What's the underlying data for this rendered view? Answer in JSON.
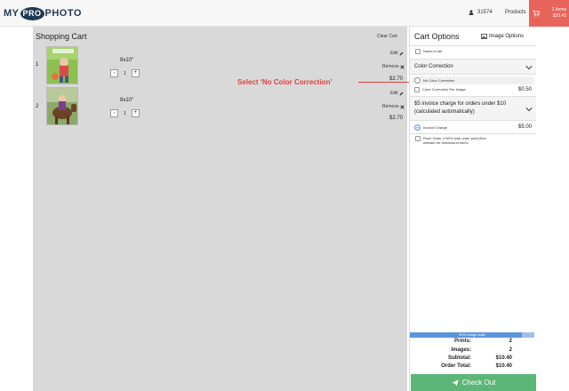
{
  "header": {
    "logo": {
      "my": "MY",
      "pro": "PRO",
      "photo": "PHOTO"
    },
    "user_id": "31574",
    "products_link": "Products",
    "cart_items": "2 Items",
    "cart_total": "$10.40",
    "user_icon": "user-icon",
    "cart_icon": "shopping-cart-icon"
  },
  "cart": {
    "title": "Shopping Cart",
    "clear_label": "Clear Cart",
    "items": [
      {
        "num": "1",
        "size": "8x10\"",
        "qty": "1",
        "edit": "Edit",
        "remove": "Remove",
        "price": "$2.70",
        "minus": "-",
        "plus": "+"
      },
      {
        "num": "2",
        "size": "8x10\"",
        "qty": "1",
        "edit": "Edit",
        "remove": "Remove",
        "price": "$2.70",
        "minus": "-",
        "plus": "+"
      }
    ]
  },
  "annotation": "Select ‘No Color Correction’",
  "options": {
    "title": "Cart Options",
    "image_options": "Image Options",
    "notes_label": "Notes to lab",
    "color_correction": {
      "header": "Color Correction",
      "options": [
        {
          "label": "No Color Correction",
          "price": ""
        },
        {
          "label": "Color Correction Per Image",
          "price": "$0.50"
        }
      ]
    },
    "invoice": {
      "header": "$5 invoice charge for orders under $10 (calculated automatically)",
      "charge_label": "Invoice Charge",
      "charge_price": "$5.00",
      "rush_label": "Rush Order (+50% total order price)See website for turnaround times."
    }
  },
  "summary": {
    "progress_text": "90% image edits",
    "progress_fraction": 0.9,
    "prints_label": "Prints:",
    "prints_value": "2",
    "images_label": "Images:",
    "images_value": "2",
    "subtotal_label": "Subtotal:",
    "subtotal_value": "$10.40",
    "order_total_label": "Order Total:",
    "order_total_value": "$10.40",
    "checkout_label": "Check Out"
  },
  "colors": {
    "accent_red": "#e8635a",
    "checkout_green": "#5bb677",
    "progress_blue": "#5d95dd",
    "annotation_red": "#e34040"
  }
}
